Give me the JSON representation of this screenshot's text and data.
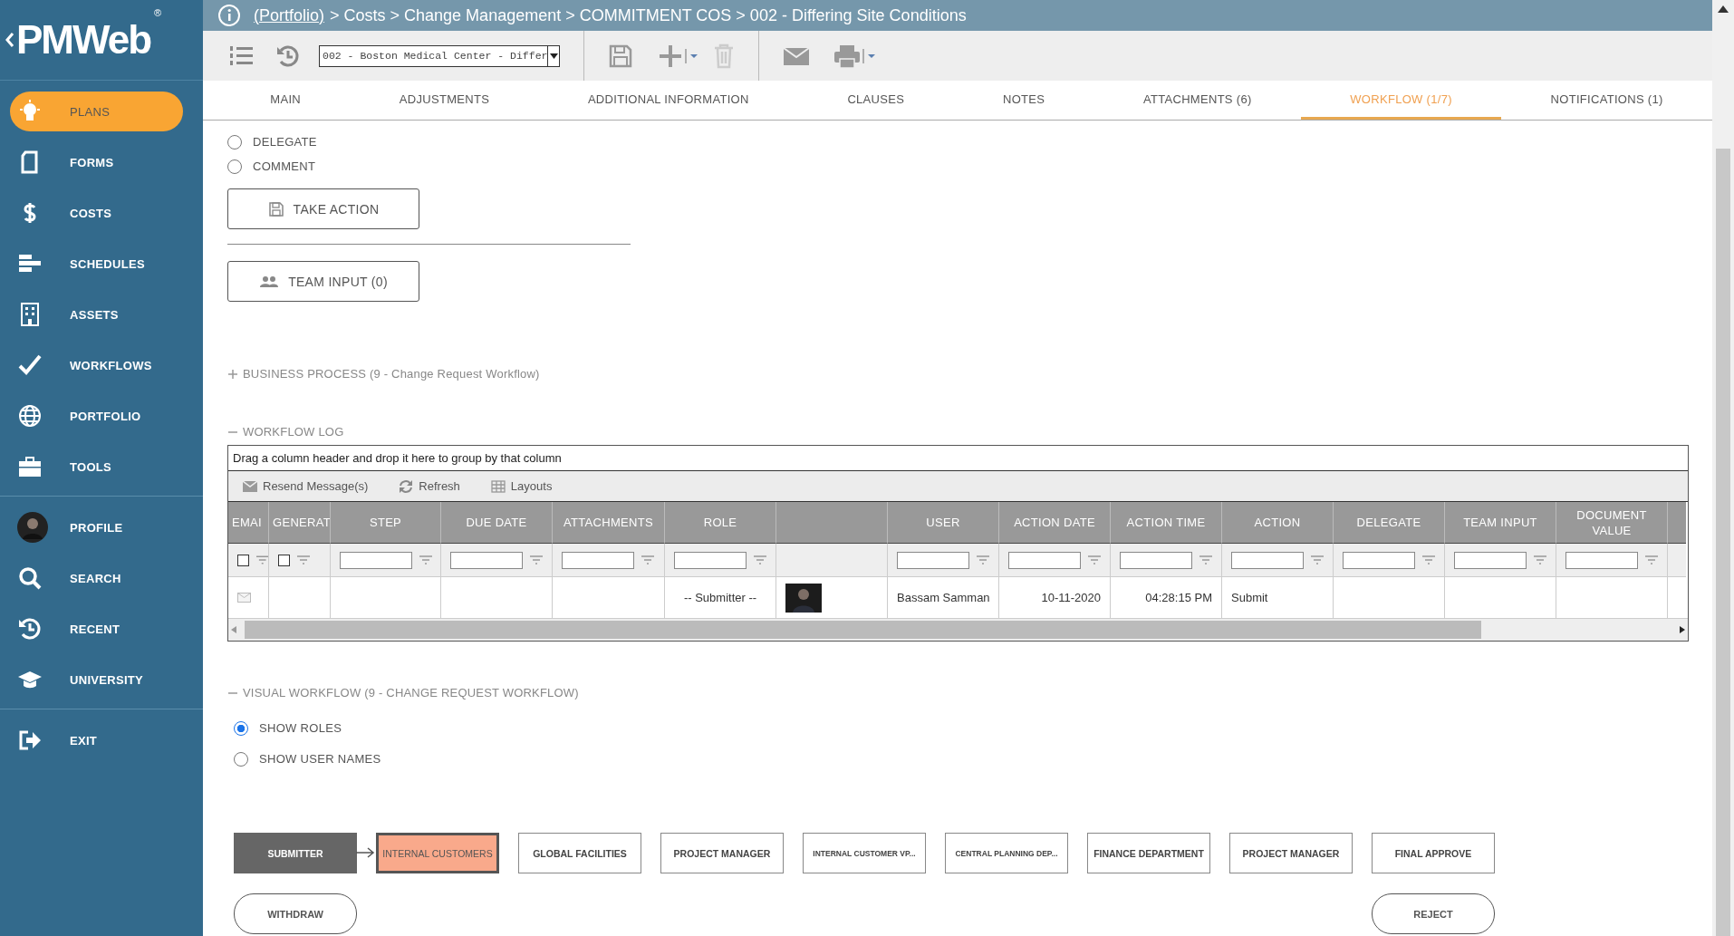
{
  "logo": {
    "text": "PMWeb",
    "mark": "®"
  },
  "sidebar": {
    "groups": [
      [
        {
          "label": "PLANS",
          "kind": "bulb",
          "selected": true
        },
        {
          "label": "FORMS",
          "kind": "document",
          "selected": false
        },
        {
          "label": "COSTS",
          "kind": "dollar",
          "selected": false
        },
        {
          "label": "SCHEDULES",
          "kind": "bars",
          "selected": false
        },
        {
          "label": "ASSETS",
          "kind": "building",
          "selected": false
        },
        {
          "label": "WORKFLOWS",
          "kind": "check",
          "selected": false
        },
        {
          "label": "PORTFOLIO",
          "kind": "globe",
          "selected": false
        },
        {
          "label": "TOOLS",
          "kind": "briefcase",
          "selected": false
        }
      ],
      [
        {
          "label": "PROFILE",
          "kind": "avatar",
          "selected": false
        },
        {
          "label": "SEARCH",
          "kind": "search",
          "selected": false
        },
        {
          "label": "RECENT",
          "kind": "history",
          "selected": false
        },
        {
          "label": "UNIVERSITY",
          "kind": "cap",
          "selected": false
        }
      ],
      [
        {
          "label": "EXIT",
          "kind": "exit",
          "selected": false
        }
      ]
    ]
  },
  "breadcrumb": {
    "link": "(Portfolio)",
    "trail": "> Costs > Change Management > COMMITMENT COS > 002 - Differing Site Conditions"
  },
  "toolbar": {
    "record": "002 - Boston Medical Center - Differ"
  },
  "tabs": [
    {
      "label": "MAIN",
      "selected": false
    },
    {
      "label": "ADJUSTMENTS",
      "selected": false
    },
    {
      "label": "ADDITIONAL INFORMATION",
      "selected": false
    },
    {
      "label": "CLAUSES",
      "selected": false
    },
    {
      "label": "NOTES",
      "selected": false
    },
    {
      "label": "ATTACHMENTS (6)",
      "selected": false
    },
    {
      "label": "WORKFLOW (1/7)",
      "selected": true
    },
    {
      "label": "NOTIFICATIONS (1)",
      "selected": false
    }
  ],
  "action_options": [
    {
      "label": "DELEGATE",
      "selected": false
    },
    {
      "label": "COMMENT",
      "selected": false
    }
  ],
  "take_action": "TAKE ACTION",
  "team_input": "TEAM INPUT (0)",
  "business_process": {
    "label": "BUSINESS PROCESS (9 - Change Request Workflow)",
    "expanded": false
  },
  "workflow_log": {
    "label": "WORKFLOW LOG",
    "expanded": true,
    "group_hint": "Drag a column header and drop it here to group by that column",
    "actions": [
      {
        "label": "Resend Message(s)",
        "kind": "mail"
      },
      {
        "label": "Refresh",
        "kind": "refresh"
      },
      {
        "label": "Layouts",
        "kind": "grid"
      }
    ],
    "columns": [
      {
        "label": "EMAI",
        "filter": {
          "kind": "checkbox",
          "checked": false
        }
      },
      {
        "label": "GENERAT",
        "filter": {
          "kind": "checkbox",
          "checked": false
        }
      },
      {
        "label": "STEP",
        "filter": {
          "kind": "text"
        }
      },
      {
        "label": "DUE DATE",
        "filter": {
          "kind": "text"
        }
      },
      {
        "label": "ATTACHMENTS",
        "filter": {
          "kind": "text"
        }
      },
      {
        "label": "ROLE",
        "filter": {
          "kind": "text"
        }
      },
      {},
      {
        "label": "USER",
        "filter": {
          "kind": "text"
        }
      },
      {
        "label": "ACTION DATE",
        "filter": {
          "kind": "text"
        }
      },
      {
        "label": "ACTION TIME",
        "filter": {
          "kind": "text"
        }
      },
      {
        "label": "ACTION",
        "filter": {
          "kind": "text"
        }
      },
      {
        "label": "DELEGATE",
        "filter": {
          "kind": "text"
        }
      },
      {
        "label": "TEAM INPUT",
        "filter": {
          "kind": "text"
        }
      },
      {
        "label": "DOCUMENT VALUE",
        "filter": {
          "kind": "text"
        }
      }
    ],
    "rows": [
      {
        "cells": [
          {
            "kind": "mail"
          },
          {
            "kind": "empty"
          },
          {
            "kind": "empty"
          },
          {
            "kind": "empty"
          },
          {
            "kind": "empty"
          },
          {
            "kind": "text",
            "text": "-- Submitter --"
          },
          {
            "kind": "photo"
          },
          {
            "kind": "text",
            "text": "Bassam Samman"
          },
          {
            "kind": "text",
            "text": "10-11-2020"
          },
          {
            "kind": "text",
            "text": "04:28:15 PM"
          },
          {
            "kind": "text",
            "text": "Submit"
          },
          {
            "kind": "empty"
          },
          {
            "kind": "empty"
          },
          {
            "kind": "empty"
          }
        ]
      }
    ]
  },
  "visual_workflow": {
    "label": "VISUAL WORKFLOW (9 - CHANGE REQUEST WORKFLOW)",
    "expanded": true,
    "view_options": [
      {
        "label": "SHOW ROLES",
        "selected": true
      },
      {
        "label": "SHOW USER NAMES",
        "selected": false
      }
    ],
    "nodes": [
      {
        "label": "SUBMITTER",
        "completed": true,
        "current": false
      },
      {
        "label": "INTERNAL CUSTOMERS",
        "completed": false,
        "current": true
      },
      {
        "label": "GLOBAL FACILITIES",
        "completed": false,
        "current": false
      },
      {
        "label": "PROJECT MANAGER",
        "completed": false,
        "current": false
      },
      {
        "label": "INTERNAL CUSTOMER VP...",
        "completed": false,
        "current": false
      },
      {
        "label": "CENTRAL PLANNING DEP...",
        "completed": false,
        "current": false
      },
      {
        "label": "FINANCE DEPARTMENT",
        "completed": false,
        "current": false
      },
      {
        "label": "PROJECT MANAGER",
        "completed": false,
        "current": false
      },
      {
        "label": "FINAL APPROVE",
        "completed": false,
        "current": false
      }
    ],
    "exits": [
      {
        "label": "WITHDRAW"
      },
      {
        "label": "REJECT"
      }
    ]
  }
}
